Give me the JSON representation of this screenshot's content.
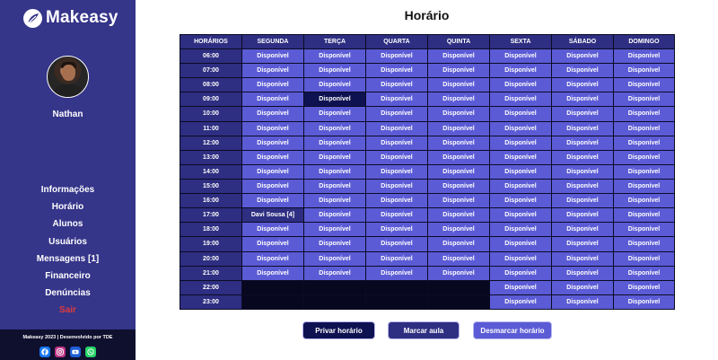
{
  "app": {
    "name": "Makeasy"
  },
  "user": {
    "name": "Nathan"
  },
  "menu": [
    {
      "label": "Informações",
      "id": "informacoes",
      "logout": false
    },
    {
      "label": "Horário",
      "id": "horario",
      "logout": false
    },
    {
      "label": "Alunos",
      "id": "alunos",
      "logout": false
    },
    {
      "label": "Usuários",
      "id": "usuarios",
      "logout": false
    },
    {
      "label": "Mensagens [1]",
      "id": "mensagens",
      "logout": false
    },
    {
      "label": "Financeiro",
      "id": "financeiro",
      "logout": false
    },
    {
      "label": "Denúncias",
      "id": "denuncias",
      "logout": false
    },
    {
      "label": "Sair",
      "id": "sair",
      "logout": true
    }
  ],
  "footer": {
    "text": "Makeasy 2023 | Desenvolvido por TDE",
    "social": [
      {
        "icon": "facebook-icon",
        "color": "#1877f2"
      },
      {
        "icon": "instagram-icon",
        "color": "#c13584"
      },
      {
        "icon": "youtube-icon",
        "color": "#1f5fd6"
      },
      {
        "icon": "whatsapp-icon",
        "color": "#25d366"
      }
    ]
  },
  "page": {
    "title": "Horário"
  },
  "schedule": {
    "headers": [
      "HORÁRIOS",
      "SEGUNDA",
      "TERÇA",
      "QUARTA",
      "QUINTA",
      "SEXTA",
      "SÁBADO",
      "DOMINGO"
    ],
    "available_label": "Disponível",
    "rows": [
      {
        "hour": "06:00",
        "cells": [
          "Disponível",
          "Disponível",
          "Disponível",
          "Disponível",
          "Disponível",
          "Disponível",
          "Disponível"
        ]
      },
      {
        "hour": "07:00",
        "cells": [
          "Disponível",
          "Disponível",
          "Disponível",
          "Disponível",
          "Disponível",
          "Disponível",
          "Disponível"
        ]
      },
      {
        "hour": "08:00",
        "cells": [
          "Disponível",
          "Disponível",
          "Disponível",
          "Disponível",
          "Disponível",
          "Disponível",
          "Disponível"
        ]
      },
      {
        "hour": "09:00",
        "cells": [
          "Disponível",
          "Disponível",
          "Disponível",
          "Disponível",
          "Disponível",
          "Disponível",
          "Disponível"
        ],
        "selected": 1
      },
      {
        "hour": "10:00",
        "cells": [
          "Disponível",
          "Disponível",
          "Disponível",
          "Disponível",
          "Disponível",
          "Disponível",
          "Disponível"
        ]
      },
      {
        "hour": "11:00",
        "cells": [
          "Disponível",
          "Disponível",
          "Disponível",
          "Disponível",
          "Disponível",
          "Disponível",
          "Disponível"
        ]
      },
      {
        "hour": "12:00",
        "cells": [
          "Disponível",
          "Disponível",
          "Disponível",
          "Disponível",
          "Disponível",
          "Disponível",
          "Disponível"
        ]
      },
      {
        "hour": "13:00",
        "cells": [
          "Disponível",
          "Disponível",
          "Disponível",
          "Disponível",
          "Disponível",
          "Disponível",
          "Disponível"
        ]
      },
      {
        "hour": "14:00",
        "cells": [
          "Disponível",
          "Disponível",
          "Disponível",
          "Disponível",
          "Disponível",
          "Disponível",
          "Disponível"
        ]
      },
      {
        "hour": "15:00",
        "cells": [
          "Disponível",
          "Disponível",
          "Disponível",
          "Disponível",
          "Disponível",
          "Disponível",
          "Disponível"
        ]
      },
      {
        "hour": "16:00",
        "cells": [
          "Disponível",
          "Disponível",
          "Disponível",
          "Disponível",
          "Disponível",
          "Disponível",
          "Disponível"
        ]
      },
      {
        "hour": "17:00",
        "cells": [
          "Davi Sousa [4]",
          "Disponível",
          "Disponível",
          "Disponível",
          "Disponível",
          "Disponível",
          "Disponível"
        ]
      },
      {
        "hour": "18:00",
        "cells": [
          "Disponível",
          "Disponível",
          "Disponível",
          "Disponível",
          "Disponível",
          "Disponível",
          "Disponível"
        ]
      },
      {
        "hour": "19:00",
        "cells": [
          "Disponível",
          "Disponível",
          "Disponível",
          "Disponível",
          "Disponível",
          "Disponível",
          "Disponível"
        ]
      },
      {
        "hour": "20:00",
        "cells": [
          "Disponível",
          "Disponível",
          "Disponível",
          "Disponível",
          "Disponível",
          "Disponível",
          "Disponível"
        ]
      },
      {
        "hour": "21:00",
        "cells": [
          "Disponível",
          "Disponível",
          "Disponível",
          "Disponível",
          "Disponível",
          "Disponível",
          "Disponível"
        ]
      },
      {
        "hour": "22:00",
        "cells": [
          "",
          "",
          "",
          "",
          "Disponível",
          "Disponível",
          "Disponível"
        ]
      },
      {
        "hour": "23:00",
        "cells": [
          "",
          "",
          "",
          "",
          "Disponível",
          "Disponível",
          "Disponível"
        ]
      }
    ]
  },
  "buttons": {
    "private_slot": "Privar horário",
    "book_class": "Marcar aula",
    "unbook_slot": "Desmarcar horário"
  }
}
